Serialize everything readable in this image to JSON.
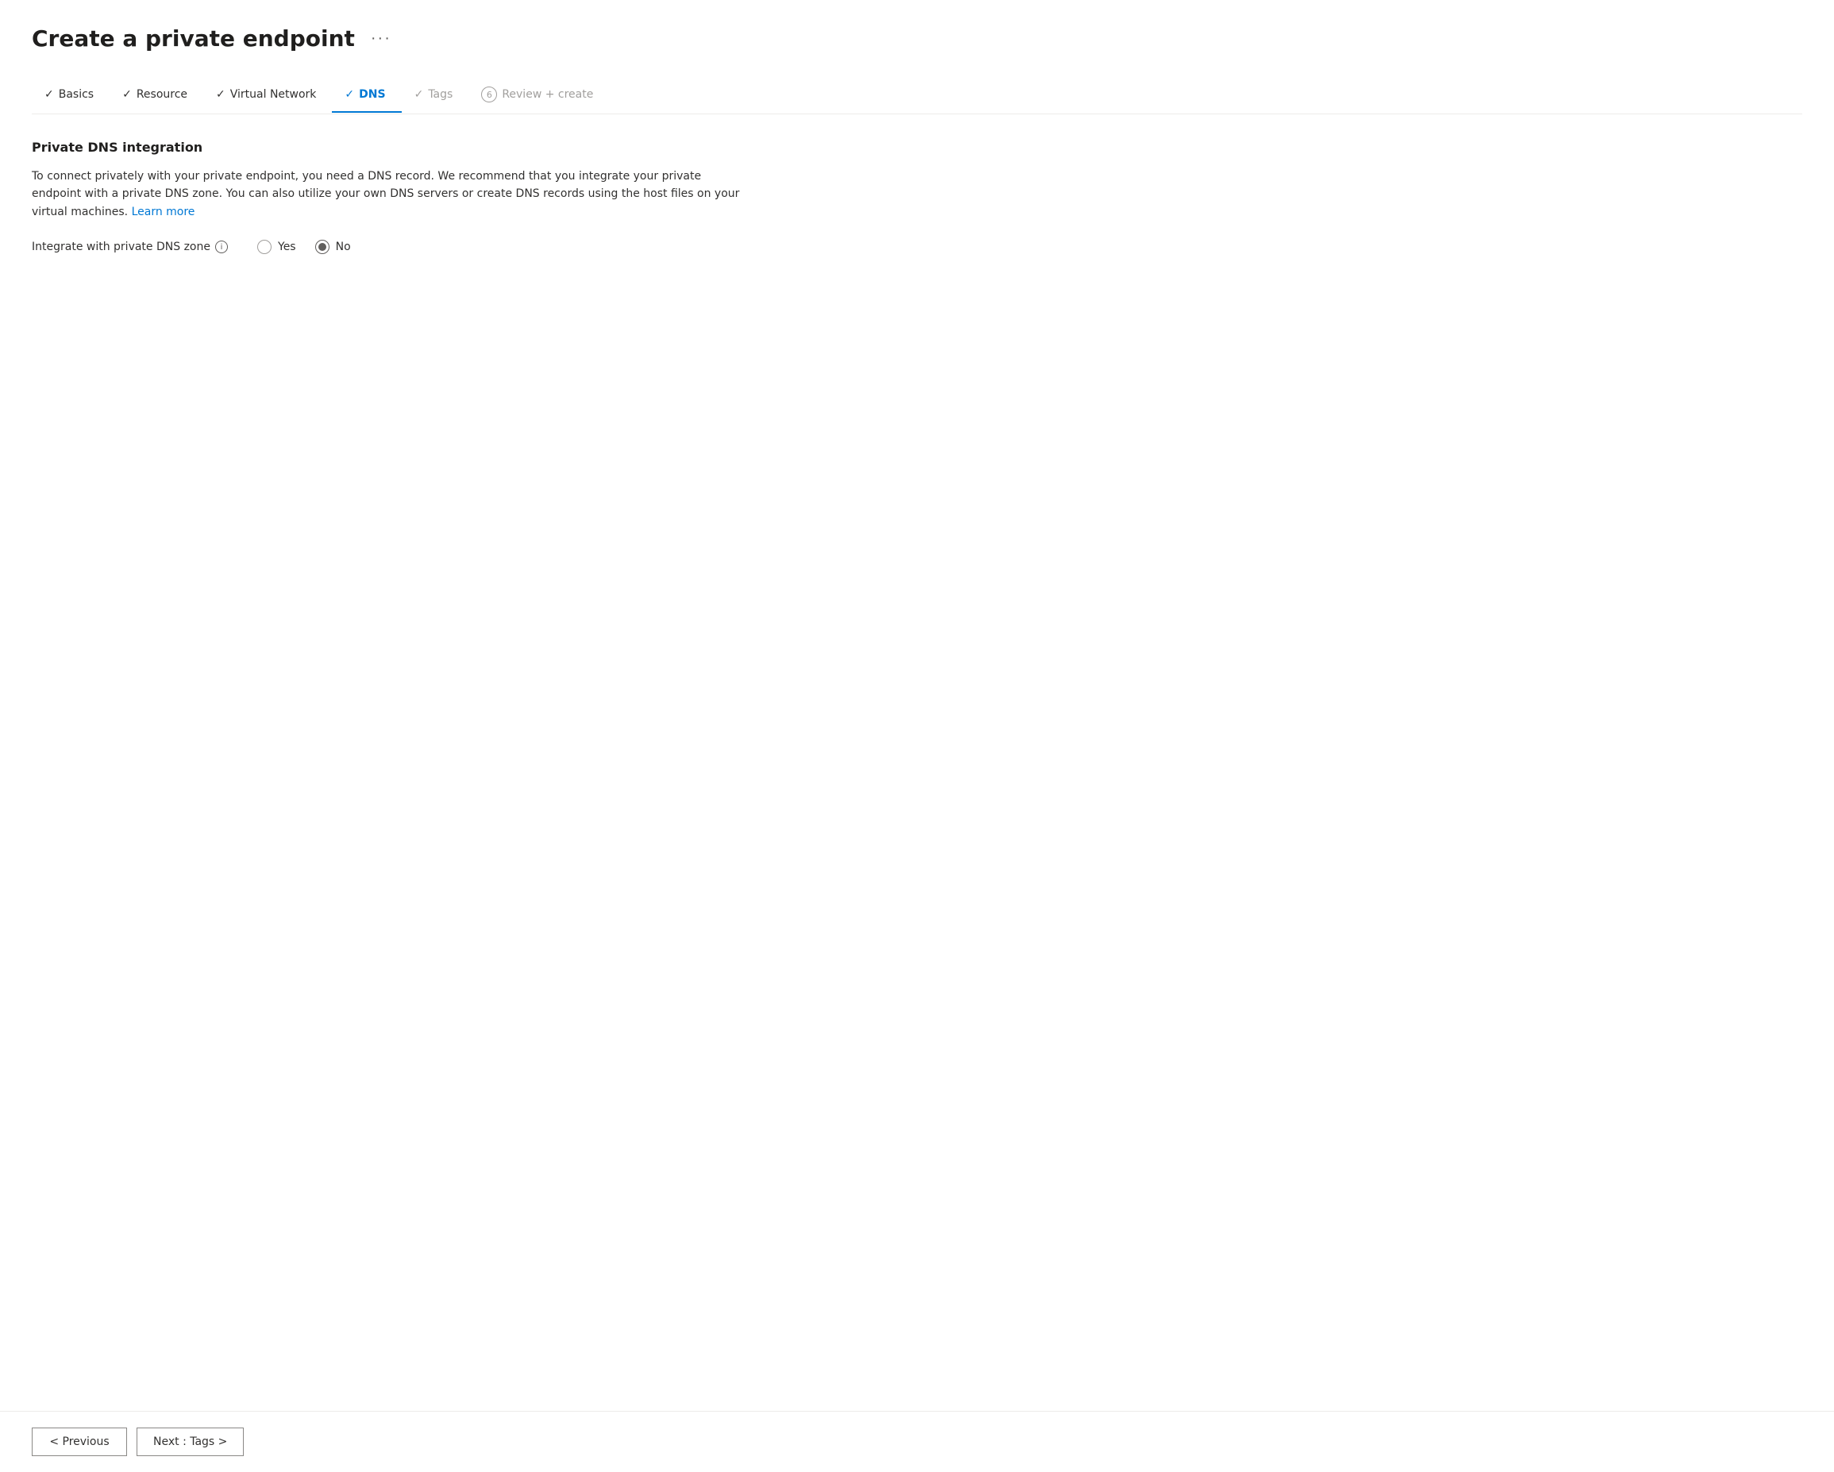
{
  "page": {
    "title": "Create a private endpoint",
    "more_options_label": "···"
  },
  "steps": [
    {
      "id": "basics",
      "label": "Basics",
      "state": "completed",
      "prefix": "✓",
      "number": null
    },
    {
      "id": "resource",
      "label": "Resource",
      "state": "completed",
      "prefix": "✓",
      "number": null
    },
    {
      "id": "virtual-network",
      "label": "Virtual Network",
      "state": "completed",
      "prefix": "✓",
      "number": null
    },
    {
      "id": "dns",
      "label": "DNS",
      "state": "active",
      "prefix": "✓",
      "number": null
    },
    {
      "id": "tags",
      "label": "Tags",
      "state": "disabled",
      "prefix": "✓",
      "number": null
    },
    {
      "id": "review-create",
      "label": "Review + create",
      "state": "disabled",
      "prefix": null,
      "number": "6"
    }
  ],
  "content": {
    "section_title": "Private DNS integration",
    "description": "To connect privately with your private endpoint, you need a DNS record. We recommend that you integrate your private endpoint with a private DNS zone. You can also utilize your own DNS servers or create DNS records using the host files on your virtual machines.",
    "learn_more_label": "Learn more",
    "field_label": "Integrate with private DNS zone",
    "info_icon_label": "i",
    "radio_yes_label": "Yes",
    "radio_no_label": "No",
    "selected_radio": "no"
  },
  "footer": {
    "previous_label": "< Previous",
    "next_label": "Next : Tags >"
  }
}
